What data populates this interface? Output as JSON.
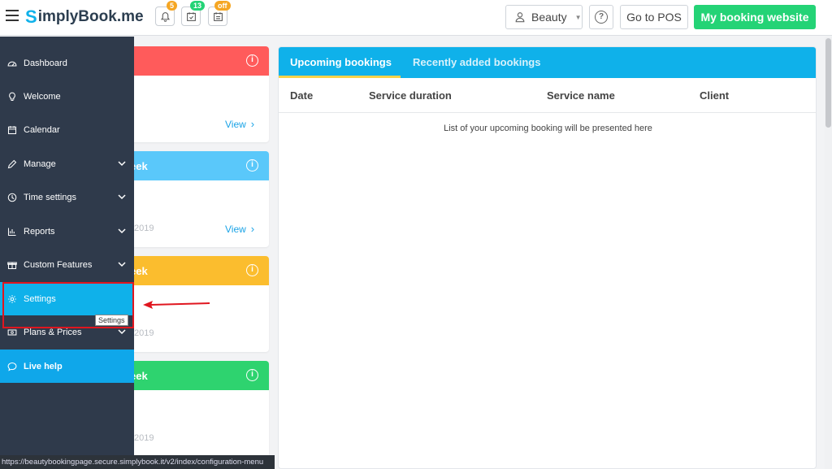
{
  "header": {
    "logo_text": "implyBook",
    "logo_mark": "S",
    "logo_suffix": ".me",
    "notifications": [
      {
        "icon": "bell-icon",
        "badge": "5",
        "badge_color": "#f5a623"
      },
      {
        "icon": "calendar-check-icon",
        "badge": "13",
        "badge_color": "#24d376"
      },
      {
        "icon": "calendar-list-icon",
        "badge": "off",
        "badge_color": "#f5a623"
      }
    ],
    "user_label": "Beauty",
    "help_label": "?",
    "pos_label": "Go to POS",
    "website_label": "My booking website"
  },
  "sidebar": {
    "items": [
      {
        "label": "Dashboard",
        "icon": "dashboard-icon"
      },
      {
        "label": "Welcome",
        "icon": "lightbulb-icon"
      },
      {
        "label": "Calendar",
        "icon": "calendar-icon"
      },
      {
        "label": "Manage",
        "icon": "pencil-icon"
      },
      {
        "label": "Time settings",
        "icon": "clock-icon"
      },
      {
        "label": "Reports",
        "icon": "bar-chart-icon"
      },
      {
        "label": "Custom Features",
        "icon": "gift-icon"
      },
      {
        "label": "Settings",
        "icon": "gear-icon"
      },
      {
        "label": "Plans & Prices",
        "icon": "price-icon"
      },
      {
        "label": "Live help",
        "icon": "chat-icon"
      }
    ],
    "tooltip": "Settings",
    "status_url": "https://beautybookingpage.secure.simplybook.it/v2/index/configuration-menu"
  },
  "cards": [
    {
      "title": "",
      "color": "#ff5b5b",
      "view_label": "View",
      "year": ""
    },
    {
      "title": "eek",
      "color": "#5ac8fa",
      "view_label": "View",
      "year": "2019"
    },
    {
      "title": "eek",
      "color": "#fbbd2e",
      "view_label": "",
      "year": "2019"
    },
    {
      "title": "eek",
      "color": "#2ed36f",
      "view_label": "",
      "year": "2019"
    }
  ],
  "bookings": {
    "tabs": [
      "Upcoming bookings",
      "Recently added bookings"
    ],
    "columns": [
      "Date",
      "Service duration",
      "Service name",
      "Client"
    ],
    "empty_message": "List of your upcoming booking will be presented here"
  }
}
